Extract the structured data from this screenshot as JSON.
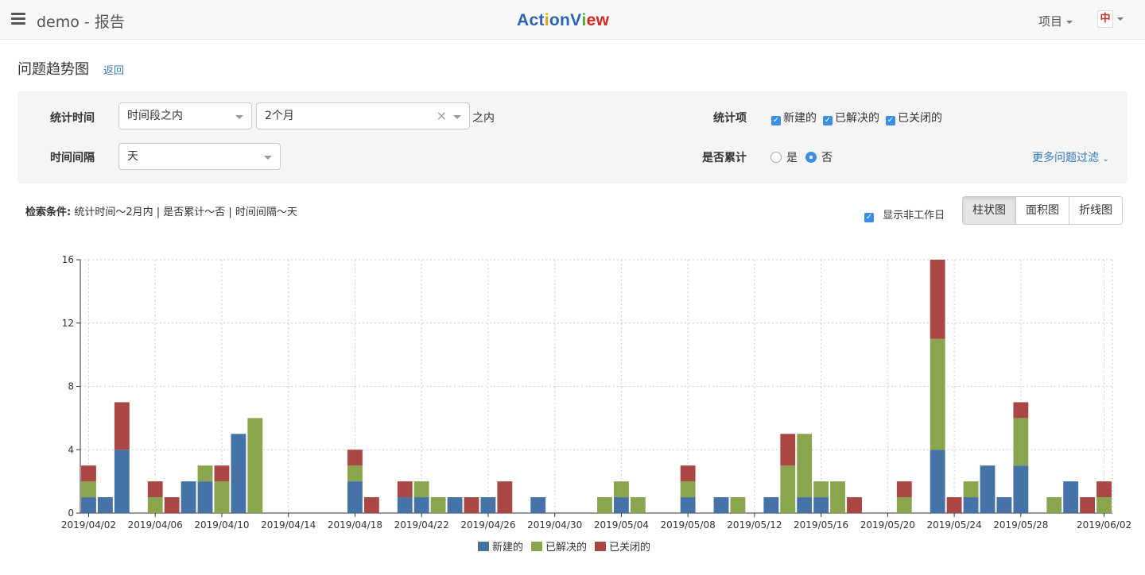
{
  "header": {
    "title": "demo - 报告",
    "brand": {
      "letters": [
        "A",
        "c",
        "t",
        "i",
        "o",
        "n",
        "V",
        "i",
        "e",
        "w"
      ],
      "colors": [
        "#2a64b8",
        "#2a64b8",
        "#2a64b8",
        "#e6a100",
        "#2a64b8",
        "#2a64b8",
        "#2a64b8",
        "#5ba33b",
        "#d9291c",
        "#d9291c"
      ]
    },
    "project_label": "项目",
    "avatar_text": "中"
  },
  "page": {
    "title": "问题趋势图",
    "back_label": "返回"
  },
  "filters": {
    "stat_time_label": "统计时间",
    "stat_time_mode": "时间段之内",
    "stat_time_value": "2个月",
    "stat_time_suffix": "之内",
    "interval_label": "时间间隔",
    "interval_value": "天",
    "stat_items_label": "统计项",
    "stat_items": [
      {
        "label": "新建的",
        "checked": true
      },
      {
        "label": "已解决的",
        "checked": true
      },
      {
        "label": "已关闭的",
        "checked": true
      }
    ],
    "cumulative_label": "是否累计",
    "cumulative_options": [
      {
        "label": "是",
        "selected": false
      },
      {
        "label": "否",
        "selected": true
      }
    ],
    "more_filter_label": "更多问题过滤"
  },
  "conditions": {
    "prefix": "检索条件:",
    "text": "统计时间～2月内 | 是否累计～否 | 时间间隔～天"
  },
  "toolbar": {
    "show_nonwork_label": "显示非工作日",
    "show_nonwork_checked": true,
    "chart_types": [
      "柱状图",
      "面积图",
      "折线图"
    ],
    "active_chart_type": "柱状图"
  },
  "chart_data": {
    "type": "bar",
    "stacked": true,
    "ylim": [
      0,
      16
    ],
    "yticks": [
      0,
      4,
      8,
      12,
      16
    ],
    "grid": true,
    "legend_position": "bottom",
    "categories": [
      "2019/04/02",
      "2019/04/03",
      "2019/04/04",
      "2019/04/05",
      "2019/04/06",
      "2019/04/07",
      "2019/04/08",
      "2019/04/09",
      "2019/04/10",
      "2019/04/11",
      "2019/04/12",
      "2019/04/13",
      "2019/04/14",
      "2019/04/15",
      "2019/04/16",
      "2019/04/17",
      "2019/04/18",
      "2019/04/19",
      "2019/04/20",
      "2019/04/21",
      "2019/04/22",
      "2019/04/23",
      "2019/04/24",
      "2019/04/25",
      "2019/04/26",
      "2019/04/27",
      "2019/04/28",
      "2019/04/29",
      "2019/04/30",
      "2019/05/01",
      "2019/05/02",
      "2019/05/03",
      "2019/05/04",
      "2019/05/05",
      "2019/05/06",
      "2019/05/07",
      "2019/05/08",
      "2019/05/09",
      "2019/05/10",
      "2019/05/11",
      "2019/05/12",
      "2019/05/13",
      "2019/05/14",
      "2019/05/15",
      "2019/05/16",
      "2019/05/17",
      "2019/05/18",
      "2019/05/19",
      "2019/05/20",
      "2019/05/21",
      "2019/05/22",
      "2019/05/23",
      "2019/05/24",
      "2019/05/25",
      "2019/05/26",
      "2019/05/27",
      "2019/05/28",
      "2019/05/29",
      "2019/05/30",
      "2019/05/31",
      "2019/06/01",
      "2019/06/02"
    ],
    "xtick_labels": [
      "2019/04/02",
      "2019/04/06",
      "2019/04/10",
      "2019/04/14",
      "2019/04/18",
      "2019/04/22",
      "2019/04/26",
      "2019/04/30",
      "2019/05/04",
      "2019/05/08",
      "2019/05/12",
      "2019/05/16",
      "2019/05/20",
      "2019/05/24",
      "2019/05/28",
      "2019/06/02"
    ],
    "series": [
      {
        "name": "新建的",
        "color": "#4572a7",
        "values": [
          1,
          1,
          4,
          0,
          0,
          0,
          2,
          2,
          0,
          5,
          0,
          0,
          0,
          0,
          0,
          0,
          2,
          0,
          0,
          1,
          1,
          0,
          1,
          0,
          1,
          0,
          0,
          1,
          0,
          0,
          0,
          0,
          1,
          0,
          0,
          0,
          1,
          0,
          1,
          0,
          0,
          1,
          0,
          1,
          1,
          0,
          0,
          0,
          0,
          0,
          0,
          4,
          0,
          1,
          3,
          1,
          3,
          0,
          0,
          2,
          0,
          0
        ]
      },
      {
        "name": "已解决的",
        "color": "#89a54e",
        "values": [
          1,
          0,
          0,
          0,
          1,
          0,
          0,
          1,
          2,
          0,
          6,
          0,
          0,
          0,
          0,
          0,
          1,
          0,
          0,
          0,
          1,
          1,
          0,
          0,
          0,
          0,
          0,
          0,
          0,
          0,
          0,
          1,
          1,
          1,
          0,
          0,
          1,
          0,
          0,
          1,
          0,
          0,
          3,
          4,
          1,
          2,
          0,
          0,
          0,
          1,
          0,
          7,
          0,
          1,
          0,
          0,
          3,
          0,
          1,
          0,
          0,
          1
        ]
      },
      {
        "name": "已关闭的",
        "color": "#aa4643",
        "values": [
          1,
          0,
          3,
          0,
          1,
          1,
          0,
          0,
          1,
          0,
          0,
          0,
          0,
          0,
          0,
          0,
          1,
          1,
          0,
          1,
          0,
          0,
          0,
          1,
          0,
          2,
          0,
          0,
          0,
          0,
          0,
          0,
          0,
          0,
          0,
          0,
          1,
          0,
          0,
          0,
          0,
          0,
          2,
          0,
          0,
          0,
          1,
          0,
          0,
          1,
          0,
          5,
          1,
          0,
          0,
          0,
          1,
          0,
          0,
          0,
          1,
          1
        ]
      }
    ]
  }
}
